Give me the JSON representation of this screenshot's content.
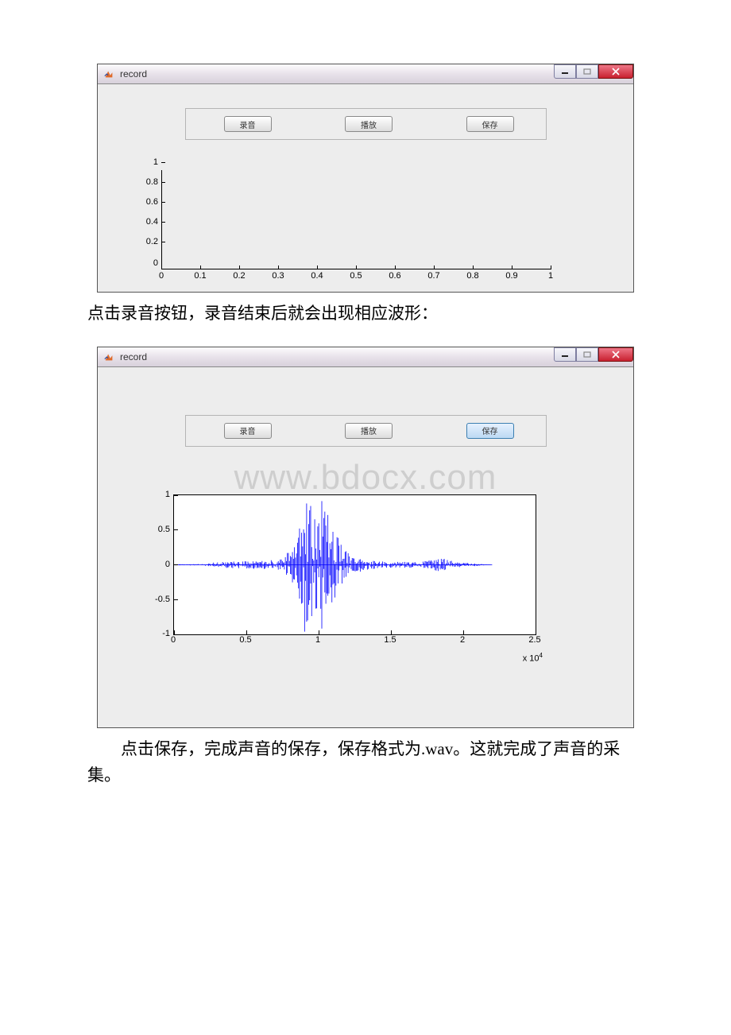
{
  "document": {
    "text_after_first_screenshot": "点击录音按钮，录音结束后就会出现相应波形：",
    "text_after_second_screenshot": "点击保存，完成声音的保存，保存格式为.wav。这就完成了声音的采集。",
    "watermark": "www.bdocx.com"
  },
  "window1": {
    "title": "record",
    "buttons": {
      "record": "录音",
      "play": "播放",
      "save": "保存"
    }
  },
  "window2": {
    "title": "record",
    "buttons": {
      "record": "录音",
      "play": "播放",
      "save": "保存"
    },
    "exponent": "x 10",
    "exponent_sup": "4"
  },
  "chart_data": [
    {
      "type": "line",
      "title": "",
      "xlabel": "",
      "ylabel": "",
      "xlim": [
        0,
        1
      ],
      "ylim": [
        0,
        1
      ],
      "xticks": [
        0,
        0.1,
        0.2,
        0.3,
        0.4,
        0.5,
        0.6,
        0.7,
        0.8,
        0.9,
        1
      ],
      "yticks": [
        0,
        0.2,
        0.4,
        0.6,
        0.8,
        1
      ],
      "series": [
        {
          "name": "empty",
          "x": [],
          "y": []
        }
      ]
    },
    {
      "type": "line",
      "title": "",
      "xlabel": "",
      "ylabel": "",
      "xlim": [
        0,
        25000
      ],
      "ylim": [
        -1,
        1
      ],
      "xticks_display": [
        0,
        0.5,
        1,
        1.5,
        2,
        2.5
      ],
      "xticks_scale": "x 10^4",
      "yticks": [
        -1,
        -0.5,
        0,
        0.5,
        1
      ],
      "series": [
        {
          "name": "recorded waveform",
          "x_range": [
            0,
            22000
          ],
          "envelope": [
            {
              "x": 0,
              "amp": 0.01
            },
            {
              "x": 2000,
              "amp": 0.01
            },
            {
              "x": 3000,
              "amp": 0.04
            },
            {
              "x": 5500,
              "amp": 0.06
            },
            {
              "x": 7500,
              "amp": 0.08
            },
            {
              "x": 8500,
              "amp": 0.35
            },
            {
              "x": 9000,
              "amp": 1.0
            },
            {
              "x": 9800,
              "amp": 0.85
            },
            {
              "x": 10200,
              "amp": 1.0
            },
            {
              "x": 10800,
              "amp": 0.7
            },
            {
              "x": 11500,
              "amp": 0.3
            },
            {
              "x": 12500,
              "amp": 0.12
            },
            {
              "x": 14000,
              "amp": 0.05
            },
            {
              "x": 17000,
              "amp": 0.04
            },
            {
              "x": 18500,
              "amp": 0.1
            },
            {
              "x": 19500,
              "amp": 0.04
            },
            {
              "x": 22000,
              "amp": 0.0
            }
          ]
        }
      ]
    }
  ],
  "ticks": {
    "small_y": [
      "1",
      "0.8",
      "0.6",
      "0.4",
      "0.2",
      "0"
    ],
    "small_x": [
      "0",
      "0.1",
      "0.2",
      "0.3",
      "0.4",
      "0.5",
      "0.6",
      "0.7",
      "0.8",
      "0.9",
      "1"
    ],
    "large_y": [
      "1",
      "0.5",
      "0",
      "-0.5",
      "-1"
    ],
    "large_x": [
      "0",
      "0.5",
      "1",
      "1.5",
      "2",
      "2.5"
    ]
  }
}
